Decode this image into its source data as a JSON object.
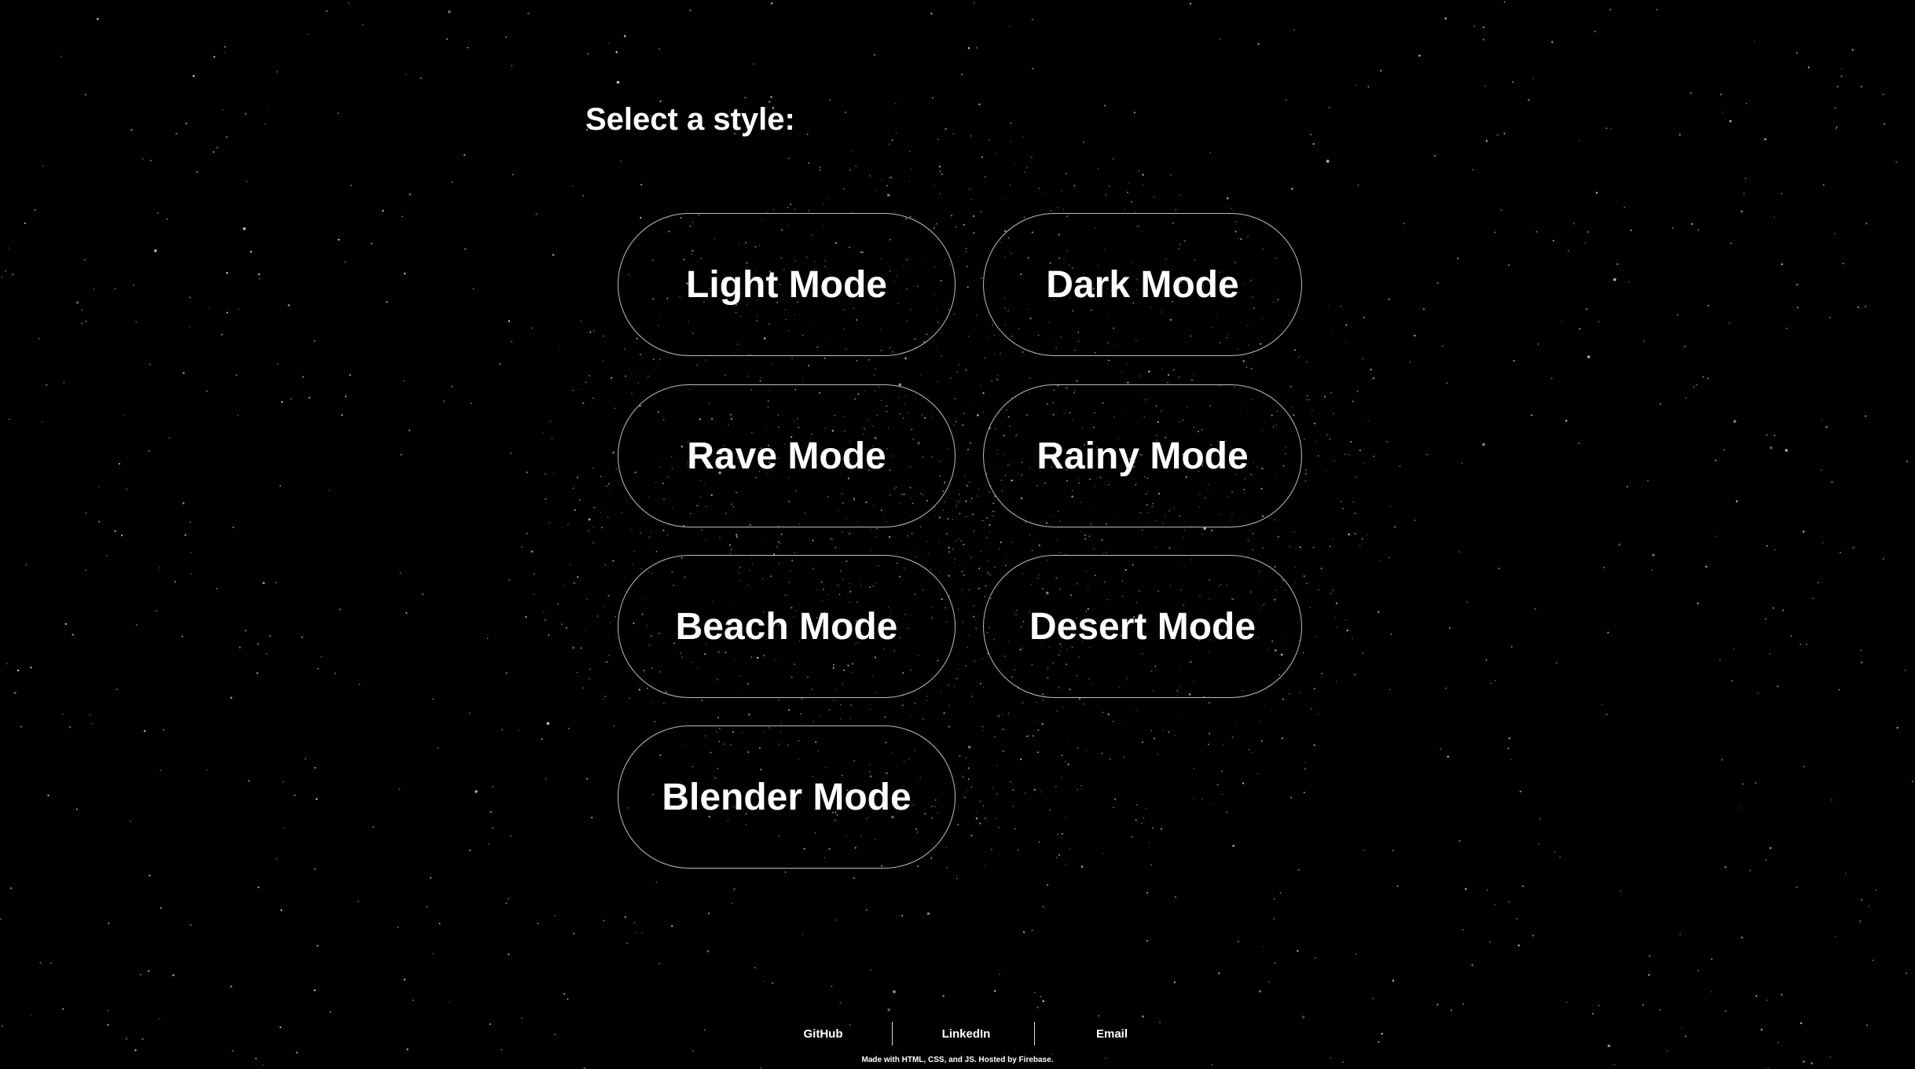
{
  "heading": "Select a style:",
  "modes": [
    {
      "label": "Light Mode"
    },
    {
      "label": "Dark Mode"
    },
    {
      "label": "Rave Mode"
    },
    {
      "label": "Rainy Mode"
    },
    {
      "label": "Beach Mode"
    },
    {
      "label": "Desert Mode"
    },
    {
      "label": "Blender Mode"
    }
  ],
  "footer": {
    "links": [
      {
        "label": "GitHub"
      },
      {
        "label": "LinkedIn"
      },
      {
        "label": "Email"
      }
    ],
    "credit": "Made with HTML, CSS, and JS. Hosted by Firebase."
  },
  "colors": {
    "background": "#000000",
    "text": "#ffffff",
    "button_border": "#bdbdbd",
    "stars": "#ffffff"
  }
}
